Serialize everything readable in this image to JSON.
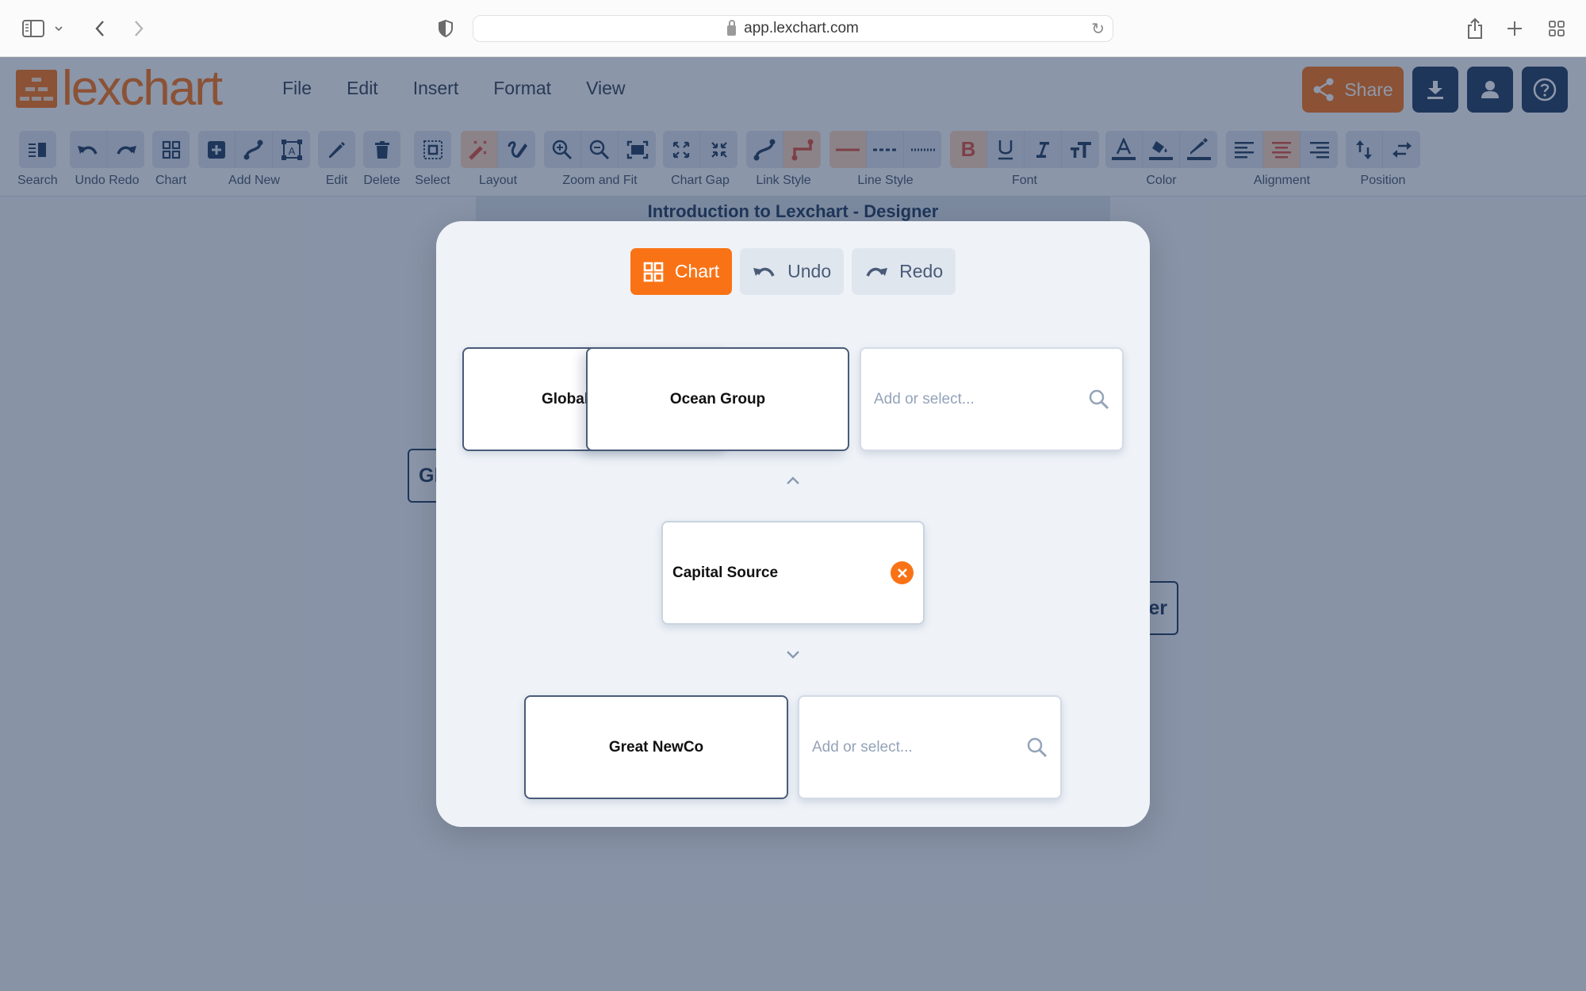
{
  "browser": {
    "url": "app.lexchart.com",
    "icons": [
      "sidebar-icon",
      "chevron-down-icon",
      "back-icon",
      "forward-icon",
      "shield-icon",
      "lock-icon",
      "reload-icon",
      "share-icon",
      "new-tab-icon",
      "tab-overview-icon"
    ]
  },
  "app": {
    "logo_text": "lexchart",
    "brand_color": "#f97316",
    "menu": [
      "File",
      "Edit",
      "Insert",
      "Format",
      "View"
    ],
    "header_buttons": {
      "share_label": "Share",
      "download_icon": "download-icon",
      "account_icon": "user-icon",
      "help_icon": "help-icon"
    }
  },
  "toolbar": {
    "groups": [
      {
        "label": "Search",
        "buttons": [
          "search-panel-icon"
        ]
      },
      {
        "label": "Undo Redo",
        "buttons": [
          "undo-icon",
          "redo-icon"
        ]
      },
      {
        "label": "Chart",
        "buttons": [
          "chart-grid-icon"
        ]
      },
      {
        "label": "Add New",
        "buttons": [
          "add-box-icon",
          "add-link-icon",
          "add-text-icon"
        ]
      },
      {
        "label": "Edit",
        "buttons": [
          "pencil-icon"
        ]
      },
      {
        "label": "Delete",
        "buttons": [
          "trash-icon"
        ]
      },
      {
        "label": "Select",
        "buttons": [
          "select-icon"
        ]
      },
      {
        "label": "Layout",
        "buttons": [
          "magic-wand-icon",
          "draw-icon"
        ],
        "active": 0
      },
      {
        "label": "Zoom and Fit",
        "buttons": [
          "zoom-in-icon",
          "zoom-out-icon",
          "fit-icon"
        ]
      },
      {
        "label": "Chart Gap",
        "buttons": [
          "expand-icon",
          "compress-icon"
        ]
      },
      {
        "label": "Link Style",
        "buttons": [
          "curved-link-icon",
          "elbow-link-icon"
        ],
        "active": 1
      },
      {
        "label": "Line Style",
        "buttons": [
          "solid-line-icon",
          "dashed-line-icon",
          "dotted-line-icon"
        ],
        "active": 0
      },
      {
        "label": "Font",
        "buttons": [
          "bold-icon",
          "underline-icon",
          "italic-icon",
          "text-size-icon"
        ],
        "active": 0
      },
      {
        "label": "Color",
        "buttons": [
          "text-color-icon",
          "fill-color-icon",
          "line-color-icon"
        ]
      },
      {
        "label": "Alignment",
        "buttons": [
          "align-left-icon",
          "align-center-icon",
          "align-right-icon"
        ],
        "active": 1
      },
      {
        "label": "Position",
        "buttons": [
          "swap-vertical-icon",
          "swap-horizontal-icon"
        ]
      }
    ]
  },
  "canvas": {
    "document_title": "Introduction to Lexchart - Designer",
    "background_nodes": [
      "Gl",
      "er"
    ]
  },
  "modal": {
    "tabs": [
      {
        "label": "Chart",
        "icon": "chart-grid-icon",
        "active": true
      },
      {
        "label": "Undo",
        "icon": "undo-icon",
        "active": false
      },
      {
        "label": "Redo",
        "icon": "redo-icon",
        "active": false
      }
    ],
    "parents": [
      {
        "label": "Global"
      },
      {
        "label": "Ocean Group"
      }
    ],
    "parent_search_placeholder": "Add or select...",
    "current_entity": "Capital Source",
    "children": [
      {
        "label": "Great NewCo"
      }
    ],
    "child_search_placeholder": "Add or select..."
  }
}
